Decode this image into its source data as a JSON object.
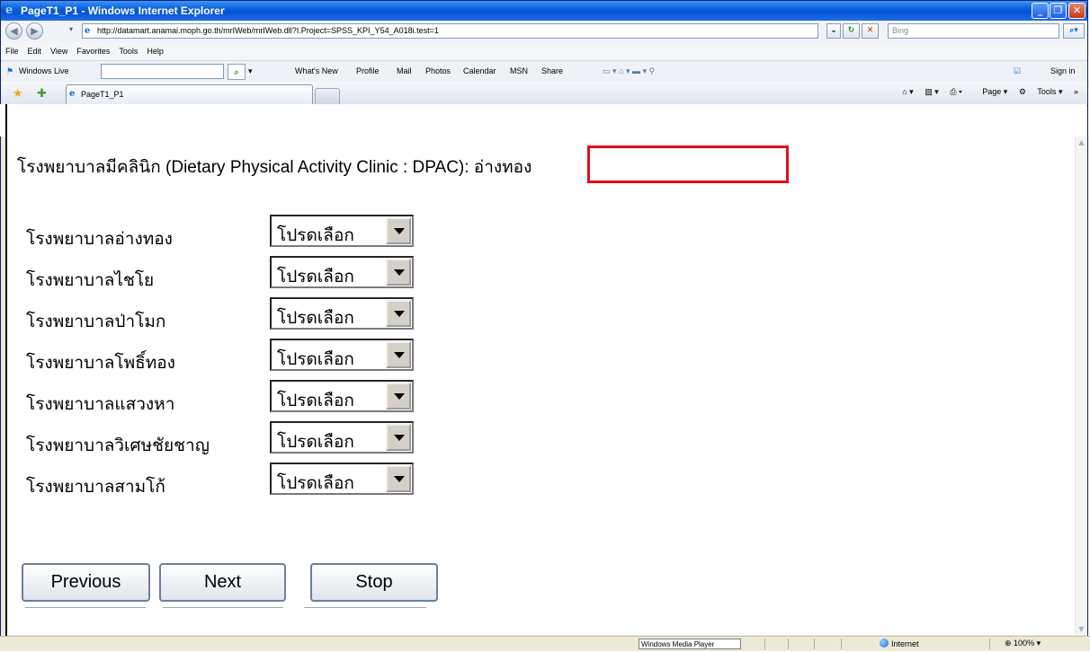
{
  "window": {
    "title": "PageT1_P1 - Windows Internet Explorer"
  },
  "address_bar": {
    "url": "http://datamart.anamai.moph.go.th/mrIWeb/mrIWeb.dll?I.Project=SPSS_KPI_Y54_A018i.test=1",
    "search_placeholder": "Bing"
  },
  "menu": {
    "items": [
      "File",
      "Edit",
      "View",
      "Favorites",
      "Tools",
      "Help"
    ]
  },
  "live_toolbar": {
    "brand": "Windows Live",
    "links": [
      "What's New",
      "Profile",
      "Mail",
      "Photos",
      "Calendar",
      "MSN",
      "Share"
    ],
    "sign_in": "Sign in"
  },
  "tabs": [
    {
      "label": "PageT1_P1"
    }
  ],
  "command_bar": {
    "page": "Page",
    "tools": "Tools"
  },
  "page": {
    "title": "โรงพยาบาลมีคลินิก (Dietary Physical Activity Clinic : DPAC): อ่างทอง",
    "rows": [
      {
        "label": "โรงพยาบาลอ่างทอง",
        "selected": "โปรดเลือก"
      },
      {
        "label": "โรงพยาบาลไชโย",
        "selected": "โปรดเลือก"
      },
      {
        "label": "โรงพยาบาลป่าโมก",
        "selected": "โปรดเลือก"
      },
      {
        "label": "โรงพยาบาลโพธิ์ทอง",
        "selected": "โปรดเลือก"
      },
      {
        "label": "โรงพยาบาลแสวงหา",
        "selected": "โปรดเลือก"
      },
      {
        "label": "โรงพยาบาลวิเศษชัยชาญ",
        "selected": "โปรดเลือก"
      },
      {
        "label": "โรงพยาบาลสามโก้",
        "selected": "โปรดเลือก"
      }
    ],
    "buttons": {
      "previous": "Previous",
      "next": "Next",
      "stop": "Stop"
    },
    "highlight_color": "#e0101a"
  },
  "status_bar": {
    "taskbar_item": "Windows Media Player",
    "zone": "Internet",
    "zoom": "100%"
  }
}
